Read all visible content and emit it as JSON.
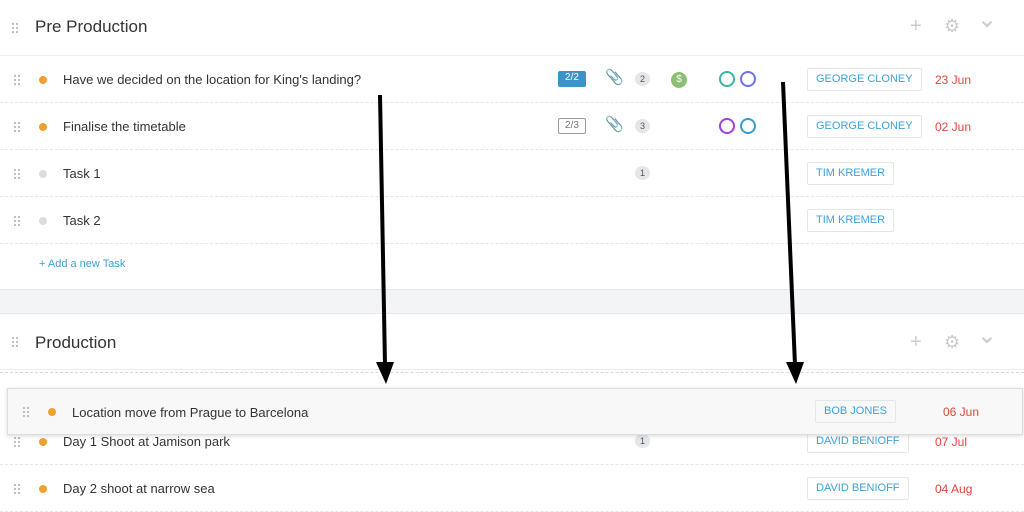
{
  "sections": [
    {
      "title": "Pre Production",
      "tasks": [
        {
          "name": "Have we decided on the location for King's landing?",
          "status_color": "#f0a030",
          "checklist": "2/2",
          "checklist_done": true,
          "attachment": true,
          "comments": "2",
          "budget": "$",
          "rings": [
            "#3fb2a8",
            "#6f6ff2"
          ],
          "assignee": "GEORGE CLONEY",
          "due": "23 Jun"
        },
        {
          "name": "Finalise the timetable",
          "status_color": "#f0a030",
          "checklist": "2/3",
          "checklist_done": false,
          "attachment": true,
          "comments": "3",
          "rings": [
            "#a040e0",
            "#3a9ad0"
          ],
          "assignee": "GEORGE CLONEY",
          "due": "02 Jun"
        },
        {
          "name": "Task 1",
          "status_color": "#ddd",
          "comments": "1",
          "assignee": "TIM KREMER"
        },
        {
          "name": "Task 2",
          "status_color": "#ddd",
          "assignee": "TIM KREMER"
        }
      ],
      "add_task": "+ Add a new Task"
    },
    {
      "title": "Production",
      "tasks": [
        {
          "name": "Location move from Prague to Barcelona",
          "status_color": "#f0a030",
          "assignee": "BOB JONES",
          "due": "06 Jun",
          "dragging": true
        },
        {
          "name": "Day 1 Shoot at Jamison park",
          "status_color": "#f0a030",
          "comments": "1",
          "assignee": "DAVID BENIOFF",
          "due": "07 Jul"
        },
        {
          "name": "Day 2 shoot at narrow sea",
          "status_color": "#f0a030",
          "assignee": "DAVID BENIOFF",
          "due": "04 Aug"
        }
      ]
    }
  ],
  "icons": {
    "add": "+",
    "settings": "⚙",
    "collapse": "⌄",
    "attachment": "📎"
  }
}
